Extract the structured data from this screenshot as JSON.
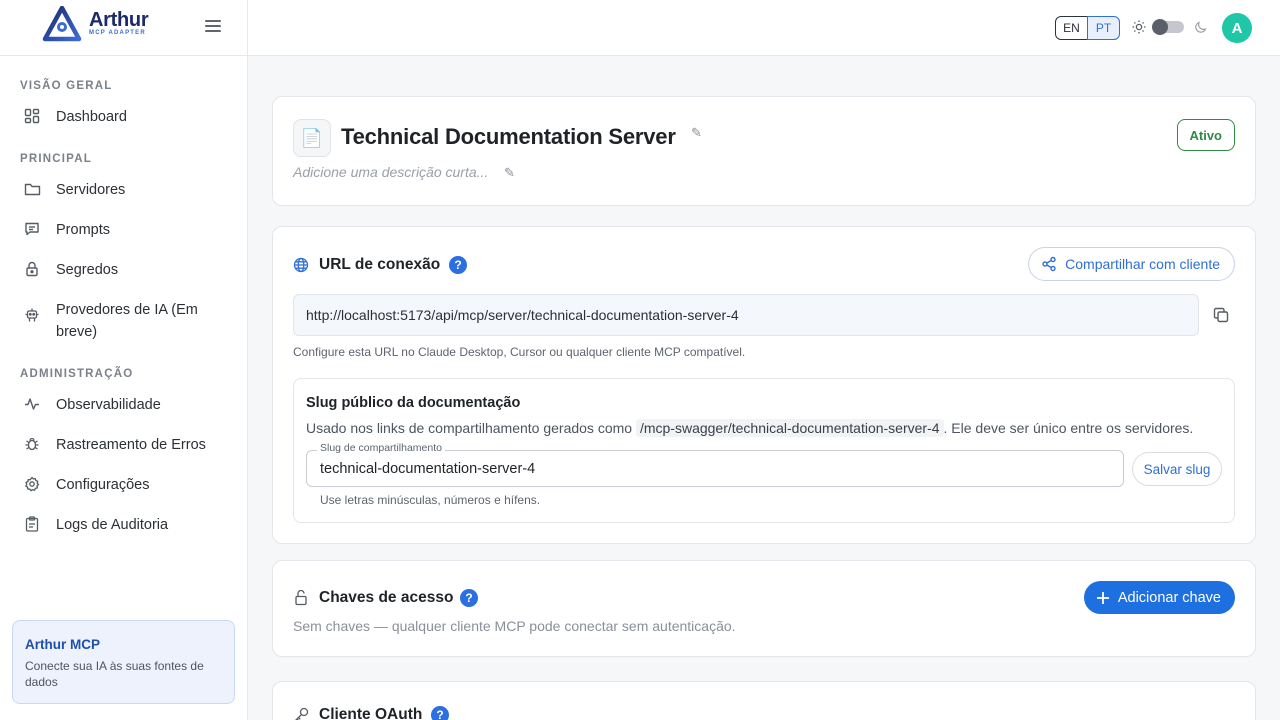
{
  "brand": {
    "name": "Arthur",
    "subtitle": "MCP ADAPTER"
  },
  "sidebar": {
    "sections": {
      "overview": "VISÃO GERAL",
      "main": "PRINCIPAL",
      "admin": "ADMINISTRAÇÃO"
    },
    "items": [
      {
        "label": "Dashboard",
        "icon": "dashboard-icon"
      },
      {
        "label": "Servidores",
        "icon": "folder-icon"
      },
      {
        "label": "Prompts",
        "icon": "message-icon"
      },
      {
        "label": "Segredos",
        "icon": "lock-icon"
      },
      {
        "label": "Provedores de IA (Em breve)",
        "icon": "robot-icon"
      },
      {
        "label": "Observabilidade",
        "icon": "activity-icon"
      },
      {
        "label": "Rastreamento de Erros",
        "icon": "bug-icon"
      },
      {
        "label": "Configurações",
        "icon": "gear-icon"
      },
      {
        "label": "Logs de Auditoria",
        "icon": "clipboard-icon"
      }
    ],
    "promo": {
      "title": "Arthur MCP",
      "text": "Conecte sua IA às suas fontes de dados"
    }
  },
  "topbar": {
    "lang_en": "EN",
    "lang_pt": "PT",
    "active_lang": "PT",
    "avatar": "A",
    "dark_mode": false
  },
  "server": {
    "title": "Technical Documentation Server",
    "description_placeholder": "Adicione uma descrição curta...",
    "status": "Ativo"
  },
  "connection": {
    "title": "URL de conexão",
    "share_label": "Compartilhar com cliente",
    "url": "http://localhost:5173/api/mcp/server/technical-documentation-server-4",
    "hint": "Configure esta URL no Claude Desktop, Cursor ou qualquer cliente MCP compatível.",
    "slug": {
      "title": "Slug público da documentação",
      "desc_prefix": "Usado nos links de compartilhamento gerados como",
      "desc_path": "/mcp-swagger/technical-documentation-server-4",
      "desc_suffix": ". Ele deve ser único entre os servidores.",
      "field_label": "Slug de compartilhamento",
      "value": "technical-documentation-server-4",
      "save_label": "Salvar slug",
      "help": "Use letras minúsculas, números e hífens."
    }
  },
  "keys": {
    "title": "Chaves de acesso",
    "add_label": "Adicionar chave",
    "empty": "Sem chaves — qualquer cliente MCP pode conectar sem autenticação."
  },
  "oauth": {
    "title": "Cliente OAuth"
  },
  "colors": {
    "accent": "#1e6fe0",
    "status": "#2e8b45",
    "avatar": "#1fc7a8"
  }
}
